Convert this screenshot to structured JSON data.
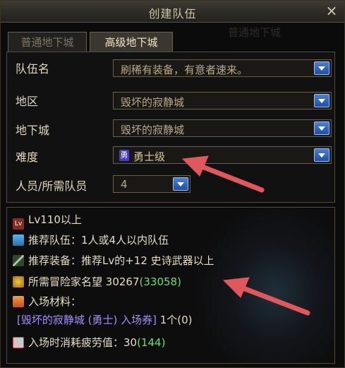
{
  "window": {
    "title": "创建队伍",
    "close_label": "×"
  },
  "tabs": [
    {
      "label": "普通地下城",
      "active": false
    },
    {
      "label": "高级地下城",
      "active": true
    }
  ],
  "ghost_tab": "普通地下城",
  "form": {
    "team_name": {
      "label": "队伍名",
      "value": "刷稀有装备，有意者速来。"
    },
    "region": {
      "label": "地区",
      "value": "毁坏的寂静城"
    },
    "dungeon": {
      "label": "地下城",
      "value": "毁坏的寂静城"
    },
    "difficulty": {
      "label": "难度",
      "value": "勇士级",
      "badge": "勇"
    },
    "members": {
      "label": "人员/所需队员",
      "value": "4"
    }
  },
  "info": {
    "level": "Lv110以上",
    "level_badge": "Lv",
    "recommend_team": "推荐队伍：1人或4人以内队伍",
    "recommend_gear": "推荐装备：推荐Lv的+12 史诗武器以上",
    "fame_label": "所需冒险家名望",
    "fame_required": "30267",
    "fame_current": "(33058)",
    "material_label": "入场材料：",
    "ticket": "[毁坏的寂静城 (勇士) 入场券]",
    "ticket_count": "1个(0)",
    "fatigue_label": "入场时消耗疲劳值：",
    "fatigue_value": "30",
    "fatigue_current": "(144)"
  },
  "colors": {
    "accent_green": "#5ee07a",
    "ticket_purple": "#a78dff",
    "arrow_red": "#e0575c",
    "dropdown_blue": "#2d62c4"
  }
}
